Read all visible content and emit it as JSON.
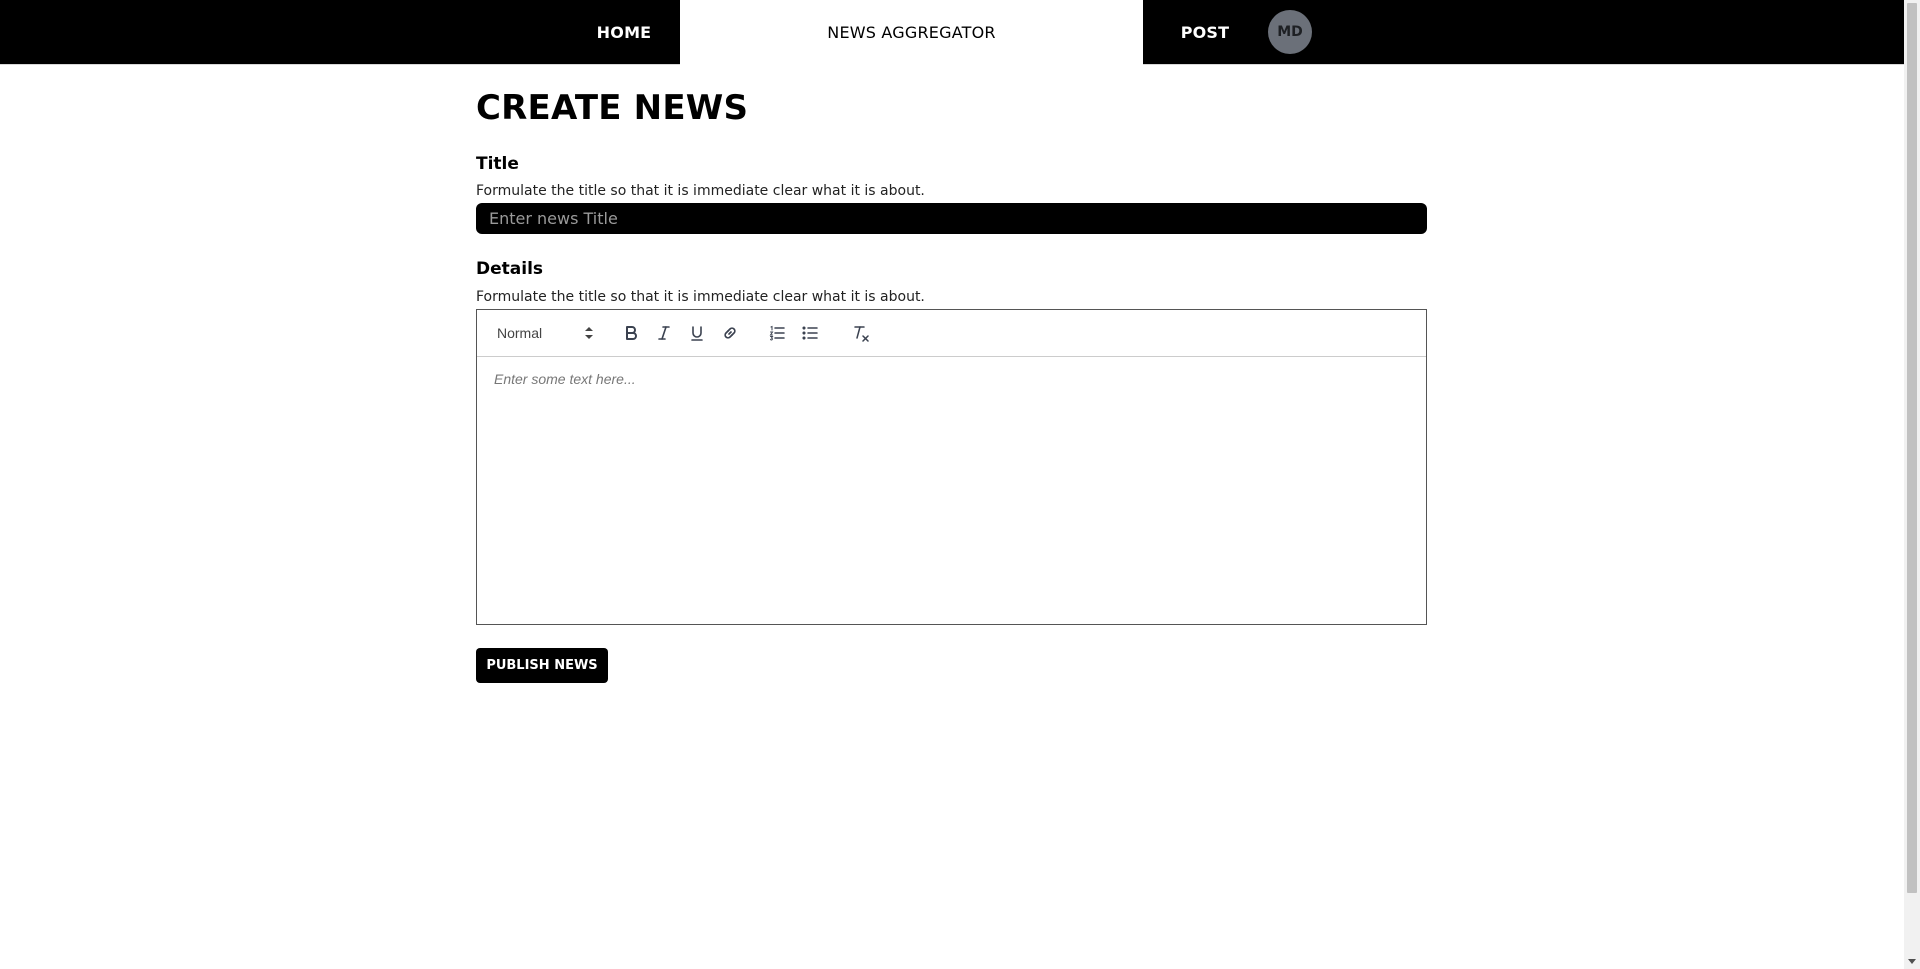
{
  "nav": {
    "home": "HOME",
    "brand": "NEWS AGGREGATOR",
    "post": "POST",
    "avatar_initials": "MD"
  },
  "page": {
    "title": "CREATE NEWS"
  },
  "form": {
    "title_label": "Title",
    "title_hint": "Formulate the title so that it is immediate clear what it is about.",
    "title_placeholder": "Enter news Title",
    "title_value": "",
    "details_label": "Details",
    "details_hint": "Formulate the title so that it is immediate clear what it is about.",
    "editor": {
      "format_value": "Normal",
      "placeholder": "Enter some text here...",
      "toolbar_icons": [
        "bold-icon",
        "italic-icon",
        "underline-icon",
        "link-icon",
        "ordered-list-icon",
        "bullet-list-icon",
        "clear-format-icon"
      ]
    },
    "publish_label": "PUBLISH NEWS"
  },
  "colors": {
    "nav_bg": "#000000",
    "brand_bg": "#ffffff",
    "avatar_bg": "#6b7079",
    "input_bg": "#000000",
    "button_bg": "#000000"
  }
}
